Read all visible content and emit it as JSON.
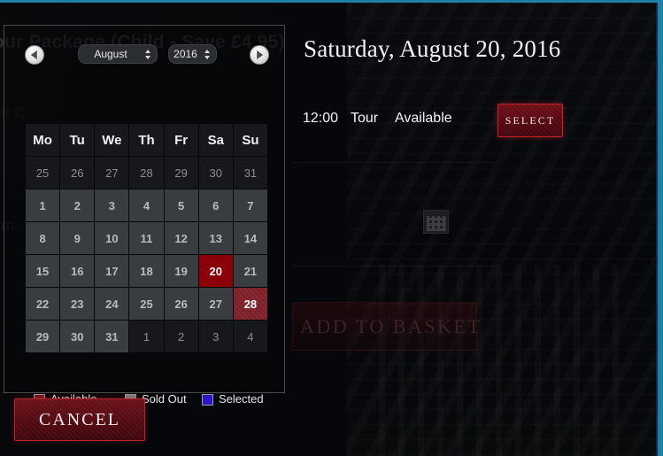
{
  "background": {
    "product_title": "our Package (Child - Save £4.95)",
    "line_one": "ir C",
    "line_two": "m",
    "add_to_basket_label": "ADD TO BASKET",
    "calendar_icon": "calendar-icon",
    "accent_stripe_color": "#1f7fa8"
  },
  "modal": {
    "header": {
      "prev_icon": "chevron-left-icon",
      "next_icon": "chevron-right-icon",
      "month": "August",
      "year": "2016",
      "spinner_icon": "updown-arrows-icon"
    },
    "weekdays": [
      "Mo",
      "Tu",
      "We",
      "Th",
      "Fr",
      "Sa",
      "Su"
    ],
    "weeks": [
      [
        {
          "day": "25",
          "state": "other"
        },
        {
          "day": "26",
          "state": "other"
        },
        {
          "day": "27",
          "state": "other"
        },
        {
          "day": "28",
          "state": "other"
        },
        {
          "day": "29",
          "state": "other"
        },
        {
          "day": "30",
          "state": "other"
        },
        {
          "day": "31",
          "state": "other"
        }
      ],
      [
        {
          "day": "1",
          "state": "soldout"
        },
        {
          "day": "2",
          "state": "soldout"
        },
        {
          "day": "3",
          "state": "soldout"
        },
        {
          "day": "4",
          "state": "soldout"
        },
        {
          "day": "5",
          "state": "soldout"
        },
        {
          "day": "6",
          "state": "soldout"
        },
        {
          "day": "7",
          "state": "soldout"
        }
      ],
      [
        {
          "day": "8",
          "state": "soldout"
        },
        {
          "day": "9",
          "state": "soldout"
        },
        {
          "day": "10",
          "state": "soldout"
        },
        {
          "day": "11",
          "state": "soldout"
        },
        {
          "day": "12",
          "state": "soldout"
        },
        {
          "day": "13",
          "state": "soldout"
        },
        {
          "day": "14",
          "state": "soldout"
        }
      ],
      [
        {
          "day": "15",
          "state": "soldout"
        },
        {
          "day": "16",
          "state": "soldout"
        },
        {
          "day": "17",
          "state": "soldout"
        },
        {
          "day": "18",
          "state": "soldout"
        },
        {
          "day": "19",
          "state": "soldout"
        },
        {
          "day": "20",
          "state": "selected"
        },
        {
          "day": "21",
          "state": "soldout"
        }
      ],
      [
        {
          "day": "22",
          "state": "soldout"
        },
        {
          "day": "23",
          "state": "soldout"
        },
        {
          "day": "24",
          "state": "soldout"
        },
        {
          "day": "25",
          "state": "soldout"
        },
        {
          "day": "26",
          "state": "soldout"
        },
        {
          "day": "27",
          "state": "soldout"
        },
        {
          "day": "28",
          "state": "available"
        }
      ],
      [
        {
          "day": "29",
          "state": "soldout"
        },
        {
          "day": "30",
          "state": "soldout"
        },
        {
          "day": "31",
          "state": "soldout"
        },
        {
          "day": "1",
          "state": "other"
        },
        {
          "day": "2",
          "state": "other"
        },
        {
          "day": "3",
          "state": "other"
        },
        {
          "day": "4",
          "state": "other"
        }
      ]
    ],
    "legend": [
      {
        "label": "Available",
        "color": "#6e1a20"
      },
      {
        "label": "Sold Out",
        "color": "#7d8084"
      },
      {
        "label": "Selected",
        "color": "#2b16c8"
      }
    ]
  },
  "detail": {
    "date_heading": "Saturday, August 20, 2016",
    "slot": {
      "time": "12:00",
      "kind": "Tour",
      "availability": "Available",
      "select_label": "SELECT"
    }
  },
  "footer": {
    "cancel_label": "CANCEL"
  }
}
